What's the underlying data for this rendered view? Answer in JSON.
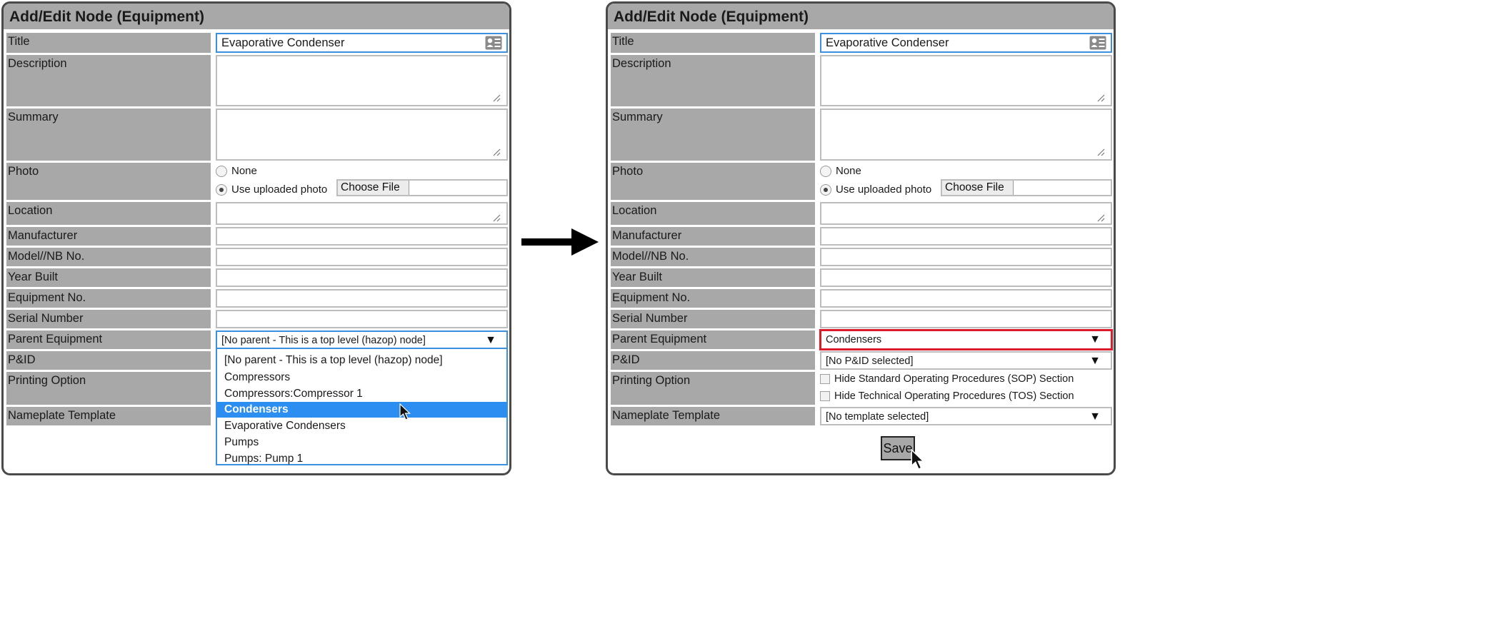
{
  "left": {
    "title": "Add/Edit Node (Equipment)",
    "labels": {
      "title": "Title",
      "description": "Description",
      "summary": "Summary",
      "photo": "Photo",
      "location": "Location",
      "manufacturer": "Manufacturer",
      "model": "Model//NB No.",
      "year": "Year Built",
      "equipment_no": "Equipment No.",
      "serial": "Serial Number",
      "parent": "Parent Equipment",
      "pid": "P&ID",
      "printing": "Printing Option",
      "nameplate": "Nameplate Template"
    },
    "title_value": "Evaporative Condenser",
    "photo_none": "None",
    "photo_uploaded": "Use uploaded photo",
    "choose_file": "Choose File",
    "parent_value": "[No parent - This is a top level (hazop) node]",
    "dropdown_options": [
      "[No parent - This is a top level (hazop) node]",
      "Compressors",
      "Compressors:Compressor 1",
      "Condensers",
      "Evaporative Condensers",
      "Pumps",
      "Pumps: Pump 1"
    ],
    "highlighted_option": "Condensers"
  },
  "right": {
    "title": "Add/Edit Node (Equipment)",
    "labels": {
      "title": "Title",
      "description": "Description",
      "summary": "Summary",
      "photo": "Photo",
      "location": "Location",
      "manufacturer": "Manufacturer",
      "model": "Model//NB No.",
      "year": "Year Built",
      "equipment_no": "Equipment No.",
      "serial": "Serial Number",
      "parent": "Parent Equipment",
      "pid": "P&ID",
      "printing": "Printing Option",
      "nameplate": "Nameplate Template"
    },
    "title_value": "Evaporative Condenser",
    "photo_none": "None",
    "photo_uploaded": "Use uploaded photo",
    "choose_file": "Choose File",
    "parent_value": "Condensers",
    "pid_value": "[No P&ID selected]",
    "printing_sop": "Hide Standard Operating Procedures (SOP) Section",
    "printing_tos": "Hide Technical Operating Procedures (TOS) Section",
    "nameplate_value": "[No template selected]",
    "save_label": "Save"
  },
  "colors": {
    "label_bg": "#a8a8a8",
    "focus_blue": "#3d8fe0",
    "highlight_red": "#dc1a2a",
    "selection_blue": "#2b8ef0"
  },
  "icons": [
    "contact-card-icon",
    "resize-handle-icon",
    "dropdown-arrow-icon",
    "mouse-cursor-icon",
    "right-arrow-icon"
  ]
}
